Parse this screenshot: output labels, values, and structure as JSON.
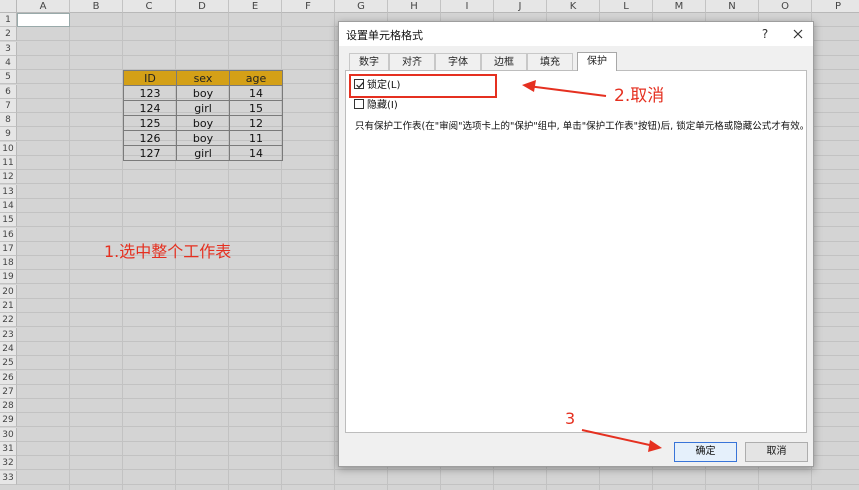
{
  "spreadsheet": {
    "columns": [
      "A",
      "B",
      "C",
      "D",
      "E",
      "F",
      "G",
      "H",
      "I",
      "J",
      "K",
      "L",
      "M",
      "N",
      "O",
      "P"
    ],
    "rows": [
      "1",
      "2",
      "3",
      "4",
      "5",
      "6",
      "7",
      "8",
      "9",
      "10",
      "11",
      "12",
      "13",
      "14",
      "15",
      "16",
      "17",
      "18",
      "19",
      "20",
      "21",
      "22",
      "23",
      "24",
      "25",
      "26",
      "27",
      "28",
      "29",
      "30",
      "31",
      "32",
      "33"
    ],
    "table": {
      "headers": [
        "ID",
        "sex",
        "age"
      ],
      "rows": [
        [
          "123",
          "boy",
          "14"
        ],
        [
          "124",
          "girl",
          "15"
        ],
        [
          "125",
          "boy",
          "12"
        ],
        [
          "126",
          "boy",
          "11"
        ],
        [
          "127",
          "girl",
          "14"
        ]
      ],
      "header_color": "#d4a017"
    }
  },
  "annotations": {
    "step1": "1.选中整个工作表",
    "step2": "2.取消",
    "step3": "3",
    "color": "#e53020"
  },
  "dialog": {
    "title": "设置单元格格式",
    "help_icon": "question-icon",
    "close_icon": "close-icon",
    "tabs": [
      "数字",
      "对齐",
      "字体",
      "边框",
      "填充",
      "保护"
    ],
    "active_tab": "保护",
    "checkbox_locked": {
      "label": "锁定(L)",
      "checked": true
    },
    "checkbox_hidden": {
      "label": "隐藏(I)",
      "checked": false
    },
    "note": "只有保护工作表(在\"审阅\"选项卡上的\"保护\"组中, 单击\"保护工作表\"按钮)后, 锁定单元格或隐藏公式才有效。",
    "ok_label": "确定",
    "cancel_label": "取消"
  }
}
